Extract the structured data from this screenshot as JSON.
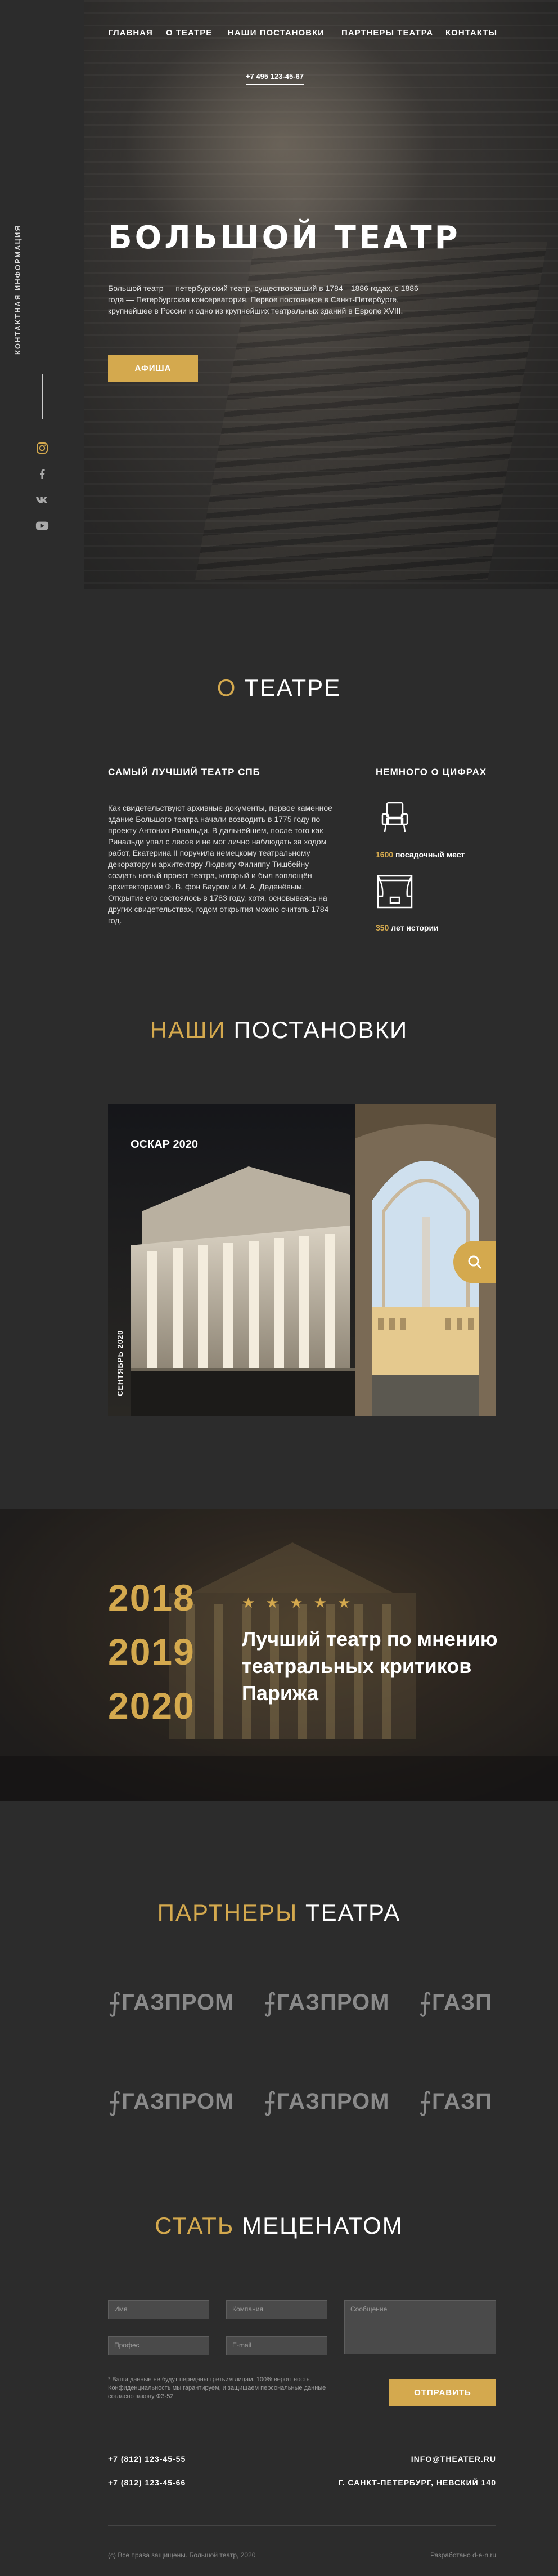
{
  "nav": {
    "items": [
      "ГЛАВНАЯ",
      "О ТЕАТРЕ",
      "НАШИ ПОСТАНОВКИ",
      "ПАРТНЕРЫ ТЕАТРА",
      "КОНТАКТЫ"
    ],
    "phone": "+7 495 123-45-67"
  },
  "sidebar": {
    "label": "КОНТАКТНАЯ ИНФОРМАЦИЯ",
    "icons": [
      "instagram-icon",
      "facebook-icon",
      "vk-icon",
      "youtube-icon"
    ]
  },
  "hero": {
    "title": "БОЛЬШОЙ ТЕАТР",
    "text": "Большой театр — петербургский театр, существовавший в 1784—1886 годах, с 1886 года — Петербургская консерватория. Первое постоянное в Санкт-Петербурге, крупнейшее в России и одно из крупнейших театральных зданий в Европе XVIII.",
    "button": "АФИША"
  },
  "about": {
    "title_accent": "О",
    "title_rest": "ТЕАТРЕ",
    "left_heading": "САМЫЙ ЛУЧШИЙ ТЕАТР СПБ",
    "left_text": "Как свидетельствуют архивные документы, первое каменное здание Большого театра начали возводить в 1775 году по проекту Антонио Ринальди. В дальнейшем, после того как Ринальди упал с лесов и не мог лично наблюдать за ходом работ, Екатерина II поручила немецкому театральному декоратору и архитектору Людвигу Филиппу Тишбейну создать новый проект театра, который и был воплощён архитекторами Ф. В. фон Бауром и М. А. Деденёвым. Открытие его состоялось в 1783 году, хотя, основываясь на других свидетельствах, годом открытия можно считать 1784 год.",
    "right_heading": "НЕМНОГО О ЦИФРАХ",
    "stats": [
      {
        "value": "1600",
        "label": "посадочный мест"
      },
      {
        "value": "350",
        "label": "лет истории"
      }
    ]
  },
  "shows": {
    "title_accent": "НАШИ",
    "title_rest": "ПОСТАНОВКИ",
    "card_title": "ОСКАР 2020",
    "card_date": "СЕНТЯБРЬ 2020"
  },
  "awards": {
    "years": [
      "2018",
      "2019",
      "2020"
    ],
    "stars": "★ ★ ★ ★ ★",
    "text": "Лучший театр по мнению театральных критиков Парижа"
  },
  "partners": {
    "title_accent": "ПАРТНЕРЫ",
    "title_rest": "ТЕАТРА",
    "logos": [
      "ГАЗПРОМ",
      "ГАЗПРОМ",
      "ГАЗП",
      "ГАЗПРОМ",
      "ГАЗПРОМ",
      "ГАЗП"
    ]
  },
  "form": {
    "title_accent": "СТАТЬ",
    "title_rest": "МЕЦЕНАТОМ",
    "name_placeholder": "Имя",
    "company_placeholder": "Компания",
    "message_placeholder": "Сообщение",
    "profession_placeholder": "Профес",
    "email_placeholder": "E-mail",
    "note": "* Ваши данные не будут переданы третьим лицам. 100% вероятность. Конфиденциальность мы гарантируем, и защищаем персональные данные согласно закону ФЗ-52",
    "submit": "ОТПРАВИТЬ"
  },
  "footer": {
    "phone1": "+7 (812) 123-45-55",
    "phone2": "+7 (812) 123-45-66",
    "email": "INFO@THEATER.RU",
    "address": "Г. САНКТ-ПЕТЕРБУРГ, НЕВСКИЙ 140",
    "copyright": "(c) Все права защищены. Большой театр, 2020",
    "dev": "Разработано d-e-n.ru"
  },
  "colors": {
    "accent": "#d4a94e",
    "background": "#2c2c2c"
  }
}
